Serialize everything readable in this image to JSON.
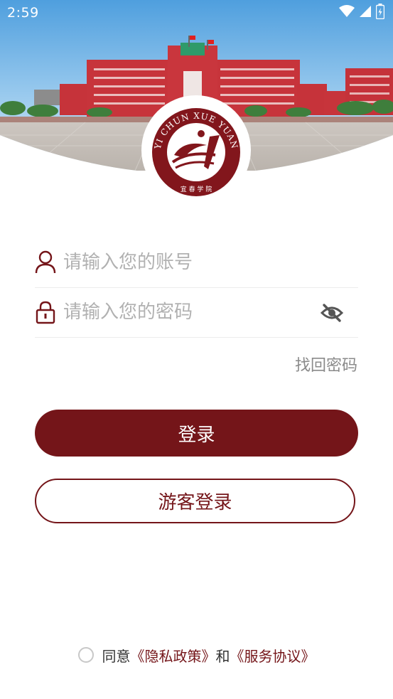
{
  "status_bar": {
    "time": "2:59",
    "icons": [
      "wifi-icon",
      "cellular-signal-icon",
      "battery-charging-icon"
    ]
  },
  "logo": {
    "ring_text": "YI CHUN XUE YUAN",
    "bottom_text": "宜 春 学 院"
  },
  "form": {
    "account_placeholder": "请输入您的账号",
    "password_placeholder": "请输入您的密码",
    "account_icon": "user-icon",
    "password_icon": "lock-icon",
    "visibility_icon": "eye-hidden-icon",
    "forgot_label": "找回密码",
    "login_label": "登录",
    "guest_label": "游客登录"
  },
  "agreement": {
    "prefix": "同意",
    "privacy_link": "《隐私政策》",
    "conjunction": "和",
    "service_link": "《服务协议》"
  },
  "colors": {
    "accent": "#741519",
    "placeholder": "#b1b1b1",
    "divider": "#ececec",
    "secondary_text": "#8a8a8a"
  }
}
